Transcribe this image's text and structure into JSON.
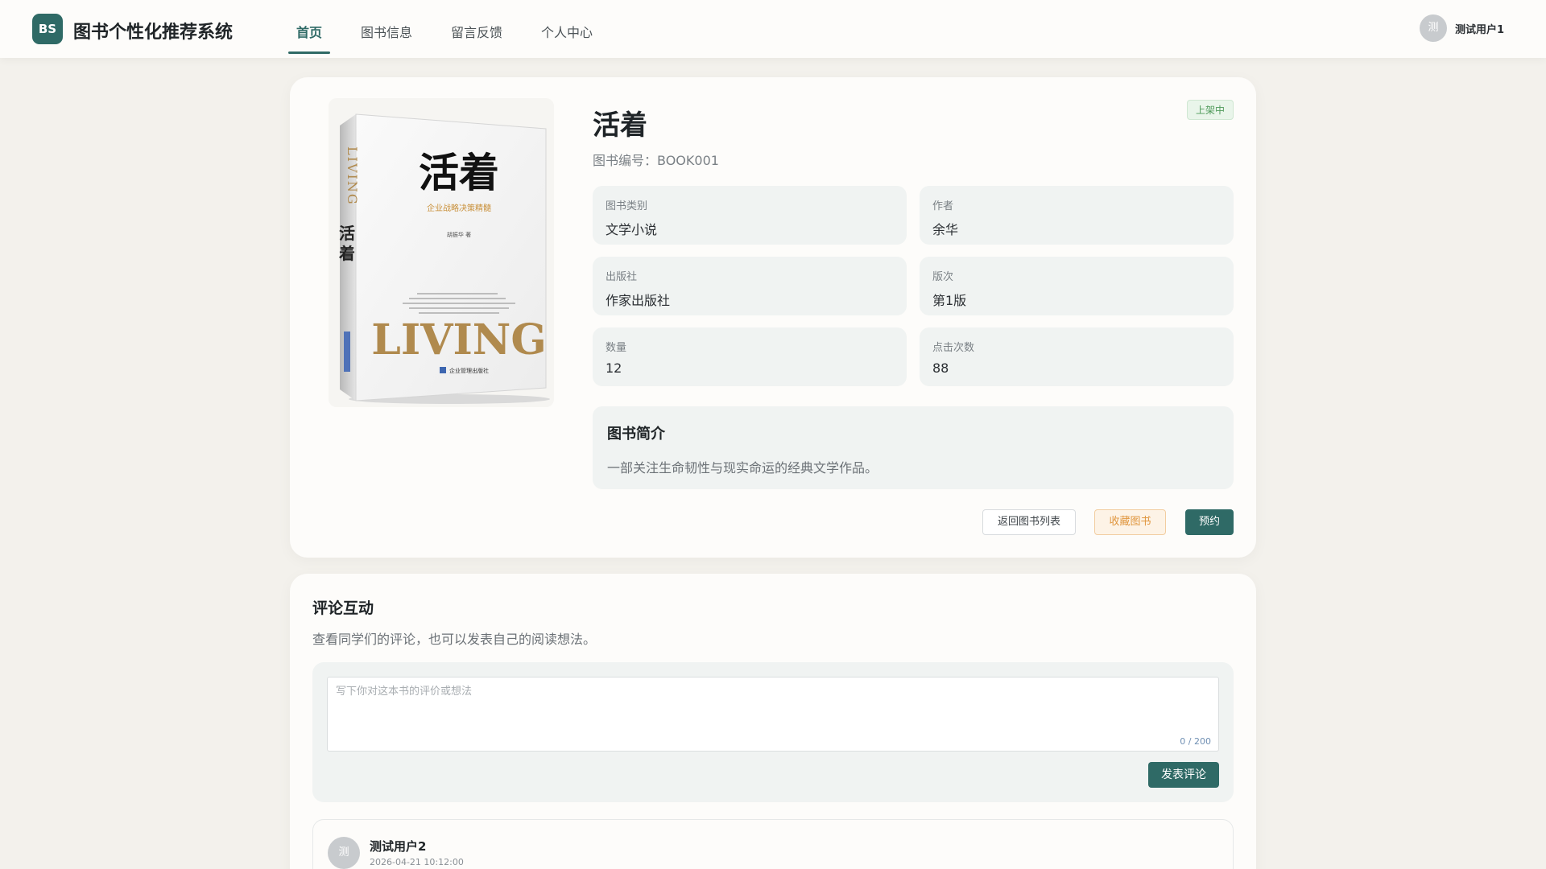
{
  "header": {
    "logo_text": "BS",
    "app_title": "图书个性化推荐系统",
    "nav": [
      {
        "label": "首页",
        "active": true
      },
      {
        "label": "图书信息",
        "active": false
      },
      {
        "label": "留言反馈",
        "active": false
      },
      {
        "label": "个人中心",
        "active": false
      }
    ],
    "user": {
      "avatar_text": "测",
      "name": "测试用户1"
    }
  },
  "book": {
    "title": "活着",
    "status": "上架中",
    "number_label": "图书编号：",
    "number": "BOOK001",
    "cover": {
      "title": "活着",
      "subtitle": "企业战略决策精髓",
      "author_line": "胡振华 著",
      "english": "LIVING",
      "publisher": "企业管理出版社"
    },
    "info": [
      {
        "label": "图书类别",
        "value": "文学小说"
      },
      {
        "label": "作者",
        "value": "余华"
      },
      {
        "label": "出版社",
        "value": "作家出版社"
      },
      {
        "label": "版次",
        "value": "第1版"
      },
      {
        "label": "数量",
        "value": "12"
      },
      {
        "label": "点击次数",
        "value": "88"
      }
    ],
    "intro_title": "图书简介",
    "intro_text": "一部关注生命韧性与现实命运的经典文学作品。",
    "buttons": {
      "back": "返回图书列表",
      "favorite": "收藏图书",
      "reserve": "预约"
    }
  },
  "comments": {
    "title": "评论互动",
    "subtitle": "查看同学们的评论，也可以发表自己的阅读想法。",
    "input_placeholder": "写下你对这本书的评价或想法",
    "char_count": "0 / 200",
    "post_label": "发表评论",
    "items": [
      {
        "avatar_text": "测",
        "user": "测试用户2",
        "time": "2026-04-21 10:12:00"
      }
    ]
  },
  "colors": {
    "accent": "#2f6a66",
    "status_green": "#4f9a5a",
    "favorite_orange": "#e0963e",
    "cover_gold": "#b08a4e"
  }
}
